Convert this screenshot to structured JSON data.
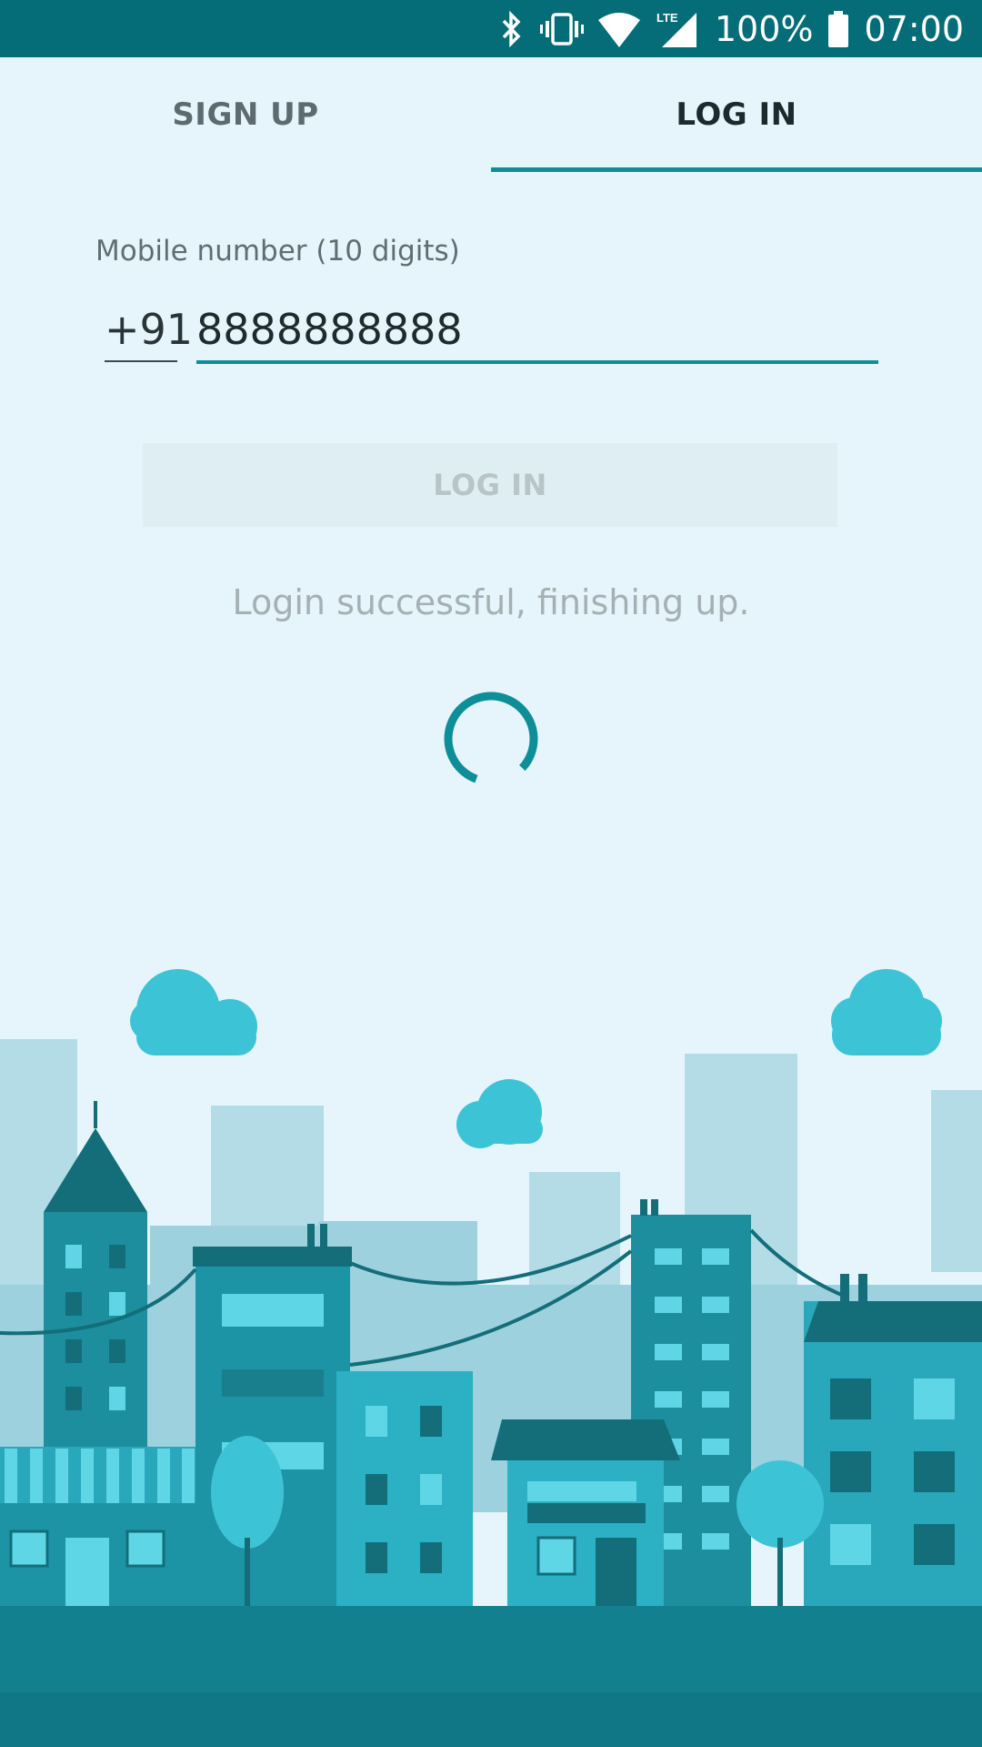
{
  "status_bar": {
    "battery": "100%",
    "time": "07:00",
    "network": "LTE",
    "icons": [
      "bluetooth-icon",
      "vibrate-icon",
      "wifi-icon",
      "signal-icon",
      "battery-icon"
    ]
  },
  "tabs": [
    {
      "label": "SIGN UP",
      "active": false
    },
    {
      "label": "LOG IN",
      "active": true
    }
  ],
  "form": {
    "label": "Mobile number (10 digits)",
    "country_code": "+91",
    "phone_value": "8888888888"
  },
  "login_button": {
    "label": "LOG IN",
    "enabled": false
  },
  "status_message": "Login successful, finishing up.",
  "colors": {
    "accent": "#0e8e98",
    "status_bar": "#046d78",
    "background": "#e6f5fb"
  }
}
